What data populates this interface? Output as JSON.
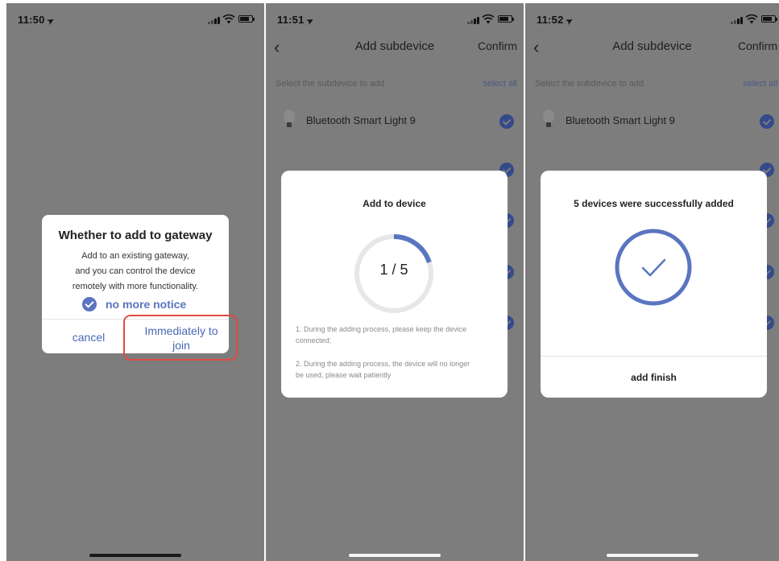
{
  "screens": [
    {
      "time": "11:50",
      "dialog": {
        "title": "Whether to add to gateway",
        "description_lines": [
          "Add to an existing gateway,",
          "and you can control the device",
          "remotely with more functionality."
        ],
        "no_more_notice": "no more notice",
        "cancel_label": "cancel",
        "join_label_lines": [
          "Immediately to",
          "join"
        ]
      }
    },
    {
      "time": "11:51",
      "nav_title": "Add subdevice",
      "confirm_label": "Confirm",
      "section_label": "Select the subdevice to add",
      "select_all_label": "select all",
      "device_name": "Bluetooth Smart Light 9",
      "dialog": {
        "title": "Add to device",
        "progress_text": "1 / 5",
        "progress_fraction": 0.2,
        "note1_lines": [
          "1. During the adding process, please keep the device",
          "connected;"
        ],
        "note2_lines": [
          "2. During the adding process, the device will no longer",
          "be used, please wait patiently"
        ]
      }
    },
    {
      "time": "11:52",
      "nav_title": "Add subdevice",
      "confirm_label": "Confirm",
      "section_label": "Select the subdevice to add",
      "select_all_label": "select all",
      "device_name": "Bluetooth Smart Light 9",
      "dialog": {
        "title": "5 devices were successfully added",
        "finish_label": "add finish"
      }
    }
  ],
  "colors": {
    "accent": "#5a75c0",
    "highlight": "#e14a43",
    "overlay": "#7d7d7d"
  },
  "icons": [
    "location-arrow-icon",
    "signal-icon",
    "wifi-icon",
    "battery-icon",
    "back-chevron-icon",
    "bulb-icon",
    "check-circle-icon"
  ]
}
